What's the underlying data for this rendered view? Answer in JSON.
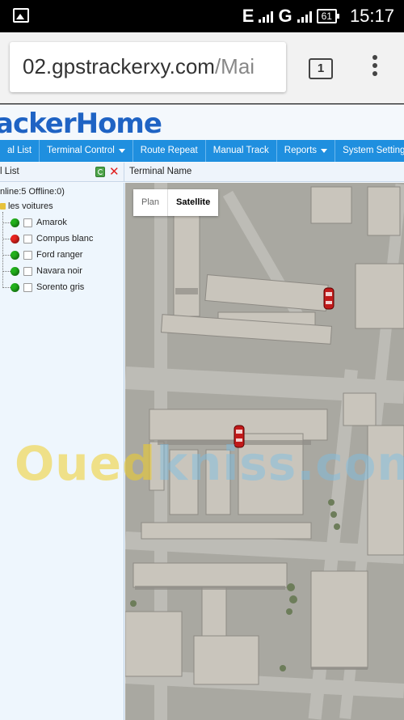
{
  "statusbar": {
    "network": "E",
    "network2": "G",
    "battery": "61",
    "time": "15:17"
  },
  "browser": {
    "url_host": "02.gpstrackerxy.com",
    "url_path": "/Mai",
    "tab_count": "1"
  },
  "app": {
    "logo": "ackerHome"
  },
  "nav": {
    "items": [
      {
        "label": "al List"
      },
      {
        "label": "Terminal Control",
        "dropdown": true
      },
      {
        "label": "Route Repeat"
      },
      {
        "label": "Manual Track"
      },
      {
        "label": "Reports",
        "dropdown": true
      },
      {
        "label": "System Settings",
        "dropdown": true
      }
    ]
  },
  "panel": {
    "left_title": "l List",
    "right_title": "Terminal Name"
  },
  "tree": {
    "status_line": "nline:5   Offline:0)",
    "group": "les voitures",
    "vehicles": [
      {
        "name": "Amarok",
        "status": "online",
        "color": "#22b11c"
      },
      {
        "name": "Compus blanc",
        "status": "offline",
        "color": "#e8231f"
      },
      {
        "name": "Ford ranger",
        "status": "online",
        "color": "#22b11c"
      },
      {
        "name": "Navara noir",
        "status": "online",
        "color": "#22b11c"
      },
      {
        "name": "Sorento gris",
        "status": "online",
        "color": "#22b11c"
      }
    ]
  },
  "map": {
    "type_plan": "Plan",
    "type_satellite": "Satellite",
    "active_type": "Satellite"
  },
  "watermark": {
    "part1": "Oued",
    "part2": "kniss.com"
  },
  "colors": {
    "accent": "#1f8fdf",
    "logo": "#1f63c4",
    "online": "#22b11c",
    "offline": "#e8231f"
  }
}
